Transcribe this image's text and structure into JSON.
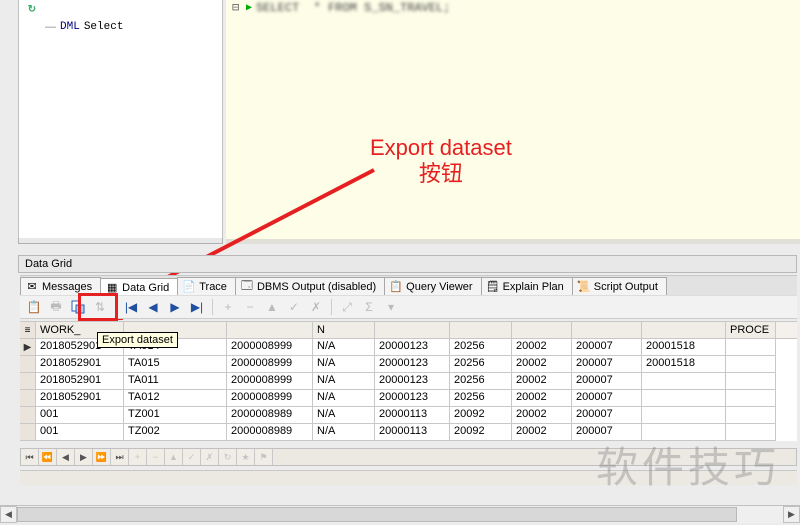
{
  "tree": {
    "node_keyword": "DML",
    "node_text": "Select"
  },
  "editor_line": "SELECT * FROM S_SN_TRAVEL;",
  "annotation": {
    "title": "Export dataset",
    "subtitle": "按钮"
  },
  "panel": {
    "title": "Data Grid"
  },
  "tabs": [
    {
      "label": "Messages",
      "icon": "message-icon",
      "icon_char": "✉"
    },
    {
      "label": "Data Grid",
      "icon": "grid-icon",
      "icon_char": "▦",
      "active": true
    },
    {
      "label": "Trace",
      "icon": "trace-icon",
      "icon_char": "📄"
    },
    {
      "label": "DBMS Output (disabled)",
      "icon": "dbms-icon",
      "icon_char": "🗔"
    },
    {
      "label": "Query Viewer",
      "icon": "query-icon",
      "icon_char": "📋"
    },
    {
      "label": "Explain Plan",
      "icon": "plan-icon",
      "icon_char": "🗒"
    },
    {
      "label": "Script Output",
      "icon": "script-icon",
      "icon_char": "📜"
    }
  ],
  "tooltip": "Export dataset",
  "columns": [
    "WORK_",
    "",
    "",
    "N",
    "",
    "",
    "",
    "",
    "",
    "PROCE"
  ],
  "rows": [
    [
      "2018052901",
      "TA014",
      "2000008999",
      "N/A",
      "20000123",
      "20256",
      "20002",
      "200007",
      "20001518",
      ""
    ],
    [
      "2018052901",
      "TA015",
      "2000008999",
      "N/A",
      "20000123",
      "20256",
      "20002",
      "200007",
      "20001518",
      ""
    ],
    [
      "2018052901",
      "TA011",
      "2000008999",
      "N/A",
      "20000123",
      "20256",
      "20002",
      "200007",
      "",
      ""
    ],
    [
      "2018052901",
      "TA012",
      "2000008999",
      "N/A",
      "20000123",
      "20256",
      "20002",
      "200007",
      "",
      ""
    ],
    [
      "001",
      "TZ001",
      "2000008989",
      "N/A",
      "20000113",
      "20092",
      "20002",
      "200007",
      "",
      ""
    ],
    [
      "001",
      "TZ002",
      "2000008989",
      "N/A",
      "20000113",
      "20092",
      "20002",
      "200007",
      "",
      ""
    ]
  ],
  "toolbar": {
    "nav": [
      "|◀",
      "◀",
      "▶",
      "▶|"
    ],
    "ops": [
      "+",
      "−",
      "▲",
      "✓",
      "✗"
    ],
    "extra": [
      "⤢",
      "Σ",
      "▾"
    ]
  },
  "watermark": "软件技巧"
}
